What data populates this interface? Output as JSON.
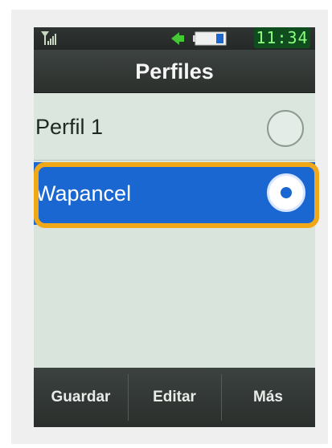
{
  "status_bar": {
    "signal_icon": "signal-bars-icon",
    "speaker_icon": "speaker-icon",
    "battery_icon": "battery-icon",
    "time": "11:34"
  },
  "screen": {
    "title": "Perfiles"
  },
  "profiles": [
    {
      "label": "Perfil 1",
      "selected": false
    },
    {
      "label": "Wapancel",
      "selected": true
    }
  ],
  "softkeys": {
    "left": "Guardar",
    "center": "Editar",
    "right": "Más"
  },
  "colors": {
    "selection_blue": "#1a67d2",
    "highlight_orange": "#f0a818",
    "list_background": "#d8e4dc",
    "bar_background": "#2f3432",
    "clock_text": "#8cff7e"
  }
}
